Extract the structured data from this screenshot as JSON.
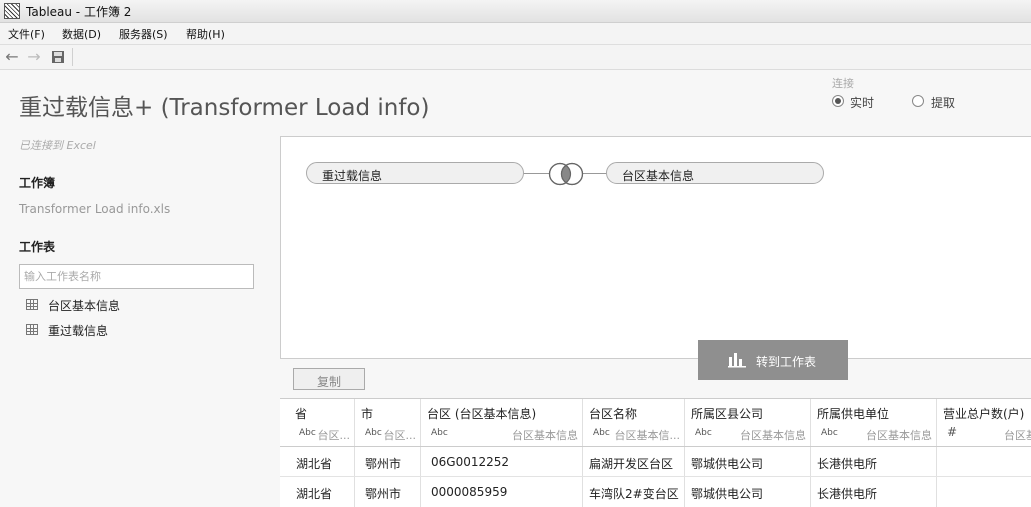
{
  "window": {
    "title": "Tableau - 工作簿 2"
  },
  "menu": [
    "文件(F)",
    "数据(D)",
    "服务器(S)",
    "帮助(H)"
  ],
  "toolbar": {
    "back_icon": "arrow-left-icon",
    "forward_icon": "arrow-right-icon",
    "save_icon": "save-icon"
  },
  "page": {
    "title": "重过载信息+ (Transformer Load info)"
  },
  "connection": {
    "label": "连接",
    "options": [
      "实时",
      "提取"
    ],
    "selected": "实时"
  },
  "sidebar": {
    "status": "已连接到 Excel",
    "workbook_heading": "工作簿",
    "workbook_file": "Transformer Load info.xls",
    "sheets_heading": "工作表",
    "search_placeholder": "输入工作表名称",
    "sheets": [
      "台区基本信息",
      "重过载信息"
    ]
  },
  "canvas": {
    "left_table": "重过载信息",
    "right_table": "台区基本信息",
    "join_type": "inner-join",
    "goto_button": "转到工作表"
  },
  "copy_button": "复制",
  "grid": {
    "columns": [
      {
        "name": "省",
        "type": "Abc",
        "source": "台区..."
      },
      {
        "name": "市",
        "type": "Abc",
        "source": "台区..."
      },
      {
        "name": "台区 (台区基本信息)",
        "type": "Abc",
        "source": "台区基本信息"
      },
      {
        "name": "台区名称",
        "type": "Abc",
        "source": "台区基本信..."
      },
      {
        "name": "所属区县公司",
        "type": "Abc",
        "source": "台区基本信息"
      },
      {
        "name": "所属供电单位",
        "type": "Abc",
        "source": "台区基本信息"
      },
      {
        "name": "营业总户数(户)",
        "type": "#",
        "source": "台区基"
      }
    ],
    "rows": [
      [
        "湖北省",
        "鄂州市",
        "06G0012252",
        "扁湖开发区台区",
        "鄂城供电公司",
        "长港供电所",
        ""
      ],
      [
        "湖北省",
        "鄂州市",
        "0000085959",
        "车湾队2#变台区",
        "鄂城供电公司",
        "长港供电所",
        ""
      ]
    ]
  }
}
